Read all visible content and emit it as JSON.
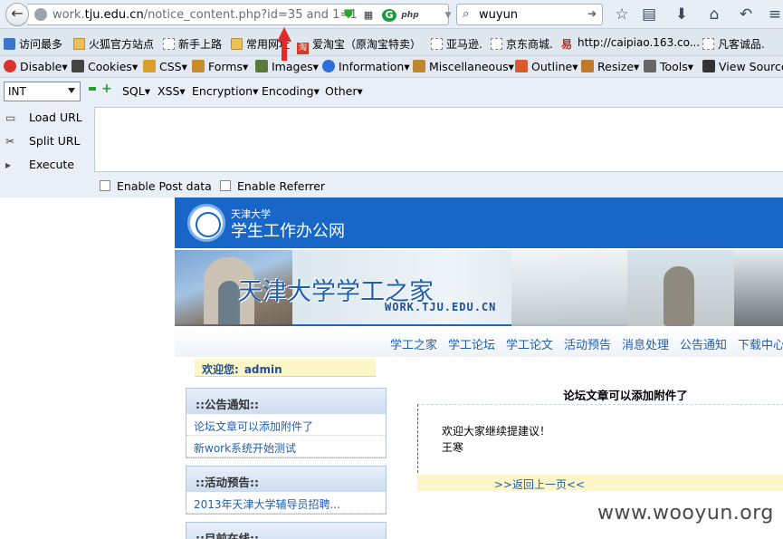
{
  "browser": {
    "url_prefix": "work.",
    "url_domain": "tju.edu.cn",
    "url_path": "/notice_content.php?id=35 and 1=1",
    "search_value": "wuyun",
    "php_badge": "php",
    "g_badge": "G"
  },
  "bookmarks": [
    {
      "label": "访问最多",
      "icon": "search-icon"
    },
    {
      "label": "火狐官方站点",
      "icon": "folder-icon"
    },
    {
      "label": "新手上路",
      "icon": "dashed-icon"
    },
    {
      "label": "常用网址",
      "icon": "folder-icon"
    },
    {
      "label": "爱淘宝（原淘宝特卖）",
      "icon": "taobao-icon"
    },
    {
      "label": "亚马逊.",
      "icon": "dashed-icon"
    },
    {
      "label": "京东商城.",
      "icon": "dashed-icon"
    },
    {
      "label": "http://caipiao.163.co...",
      "icon": "yi-icon"
    },
    {
      "label": "凡客诚品.",
      "icon": "dashed-icon"
    }
  ],
  "taobao_glyph": "淘",
  "yi_glyph": "易",
  "devbar": [
    {
      "label": "Disable▾",
      "color": "#d9342b"
    },
    {
      "label": "Cookies▾",
      "color": "#444444"
    },
    {
      "label": "CSS▾",
      "color": "#d9a02b"
    },
    {
      "label": "Forms▾",
      "color": "#c98b2b"
    },
    {
      "label": "Images▾",
      "color": "#5a7a3a"
    },
    {
      "label": "Information▾",
      "color": "#2b6fd9"
    },
    {
      "label": "Miscellaneous▾",
      "color": "#c0862b"
    },
    {
      "label": "Outline▾",
      "color": "#d95a2b"
    },
    {
      "label": "Resize▾",
      "color": "#c07a2b"
    },
    {
      "label": "Tools▾",
      "color": "#666666"
    },
    {
      "label": "View Source▾",
      "color": "#333333"
    }
  ],
  "hackbar": {
    "select_value": "INT",
    "menu": [
      "SQL▾",
      "XSS▾",
      "Encryption▾",
      "Encoding▾",
      "Other▾"
    ],
    "load_url": "Load URL",
    "split_url": "Split URL",
    "execute": "Execute",
    "post_data": "Enable Post data",
    "referrer": "Enable Referrer",
    "textarea_value": ""
  },
  "site": {
    "header_small": "天津大学",
    "header_big": "学生工作办公网",
    "banner_title": "天津大学学工之家",
    "banner_sub": "WORK.TJU.EDU.CN",
    "nav": [
      "学工之家",
      "学工论坛",
      "学工论文",
      "活动预告",
      "消息处理",
      "公告通知",
      "下载中心"
    ],
    "welcome_label": "欢迎您:",
    "welcome_user": "admin",
    "notice_title": "::公告通知::",
    "notice_items": [
      "论坛文章可以添加附件了",
      "新work系统开始测试"
    ],
    "events_title": "::活动预告::",
    "events_items": [
      "2013年天津大学辅导员招聘..."
    ],
    "online_title": "::目前在线::",
    "article_title": "论坛文章可以添加附件了",
    "article_line1": "欢迎大家继续提建议！",
    "article_line2": "王寒",
    "back_link": ">>返回上一页<<"
  },
  "watermark": "www.wooyun.org"
}
